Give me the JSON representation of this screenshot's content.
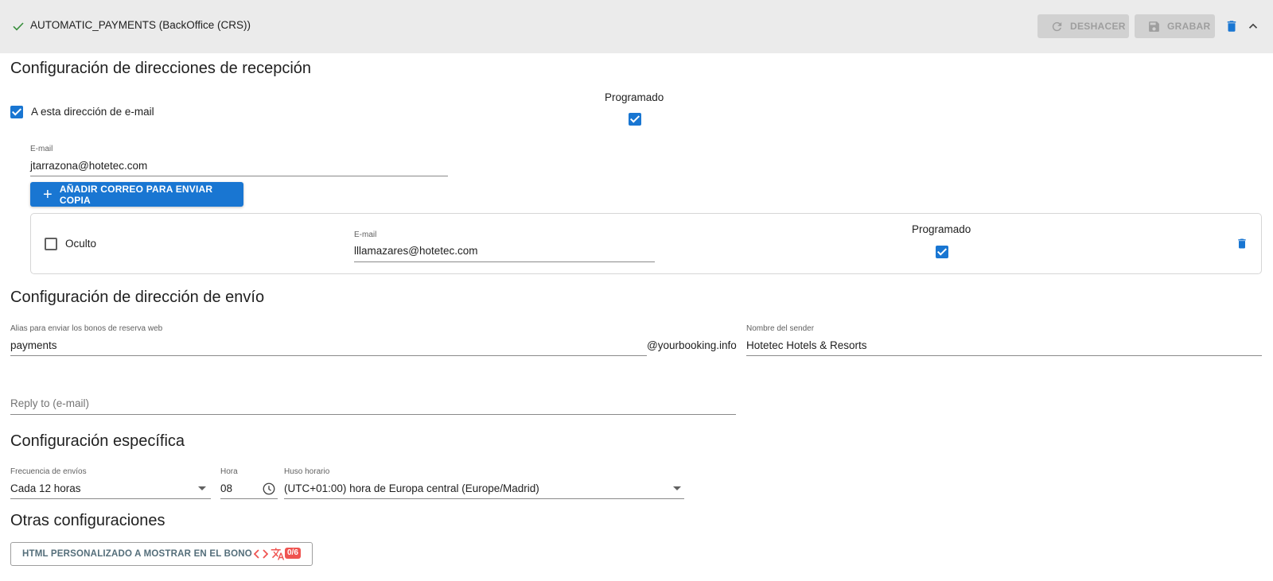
{
  "header": {
    "title": "AUTOMATIC_PAYMENTS (BackOffice (CRS))",
    "undo_label": "DESHACER",
    "save_label": "GRABAR",
    "status_color": "#388e3c",
    "delete_color": "#1976d2"
  },
  "reception": {
    "heading": "Configuración de direcciones de recepción",
    "to_address_label": "A esta dirección de e-mail",
    "to_address_checked": true,
    "scheduled_label": "Programado",
    "scheduled_checked": true,
    "email_label": "E-mail",
    "email_value": "jtarrazona@hotetec.com",
    "add_copy_label": "AÑADIR CORREO PARA ENVIAR COPIA",
    "copies": [
      {
        "hidden_label": "Oculto",
        "hidden_checked": false,
        "email_label": "E-mail",
        "email_value": "lllamazares@hotetec.com",
        "scheduled_label": "Programado",
        "scheduled_checked": true
      }
    ]
  },
  "sending": {
    "heading": "Configuración de dirección de envío",
    "alias_label": "Alias para enviar los bonos de reserva web",
    "alias_value": "payments",
    "domain_suffix": "@yourbooking.info",
    "sender_label": "Nombre del sender",
    "sender_value": "Hotetec Hotels & Resorts",
    "reply_to_placeholder": "Reply to (e-mail)"
  },
  "specific": {
    "heading": "Configuración específica",
    "frequency_label": "Frecuencia de envíos",
    "frequency_value": "Cada 12 horas",
    "hour_label": "Hora",
    "hour_value": "08",
    "timezone_label": "Huso horario",
    "timezone_value": "(UTC+01:00) hora de Europa central (Europe/Madrid)"
  },
  "other": {
    "heading": "Otras configuraciones",
    "custom_html_label": "HTML PERSONALIZADO A MOSTRAR EN EL BONO",
    "translation_badge": "0/6",
    "icon_color": "#ef5350"
  },
  "colors": {
    "primary": "#1976d2",
    "header_bg": "#ebebeb",
    "disabled_btn_bg": "#d1d1d1"
  }
}
